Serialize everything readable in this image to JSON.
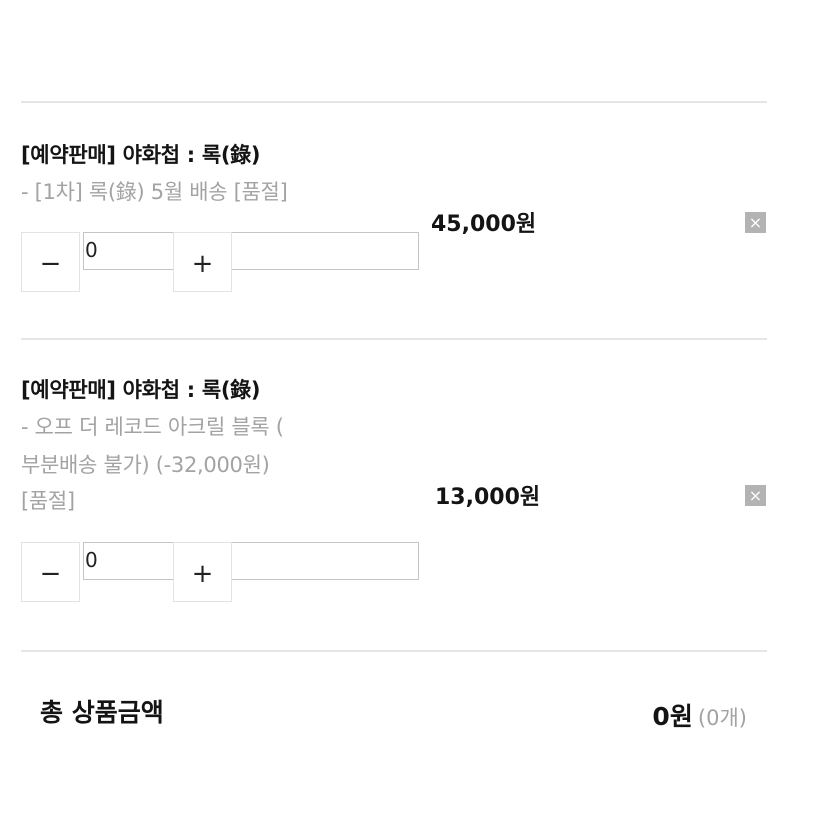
{
  "items": [
    {
      "title": "[예약판매] 야화첩 : 록(錄)",
      "option_lines": [
        "- [1차] 록(錄) 5월 배송 [품절]"
      ],
      "quantity": "0",
      "price": "45,000원",
      "delete_icon": "close-icon"
    },
    {
      "title": "[예약판매] 야화첩 : 록(錄)",
      "option_lines": [
        "- 오프 더 레코드 아크릴 블록 (",
        "부분배송 불가) (-32,000원)",
        "[품절]"
      ],
      "quantity": "0",
      "price": "13,000원",
      "delete_icon": "close-icon"
    }
  ],
  "controls": {
    "minus_label": "−",
    "plus_label": "+",
    "delete_label": "×"
  },
  "total": {
    "label": "총 상품금액",
    "price": "0원",
    "count": "(0개)"
  }
}
